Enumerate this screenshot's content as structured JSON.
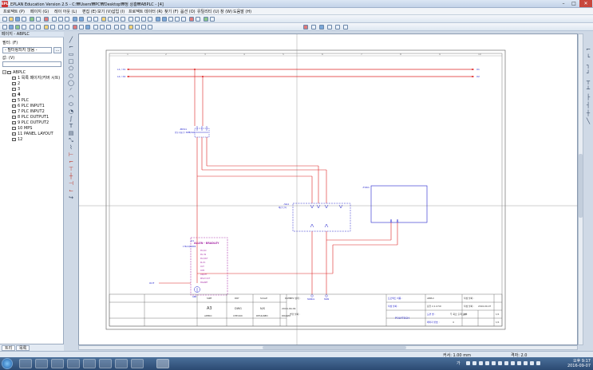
{
  "window": {
    "title": "EPLAN Education Version 2.5 - C:₩Users₩PC₩Desktop₩정 상흠₩ABPLC - [4]",
    "app_icon": "EPLAN"
  },
  "menu": [
    "프로젝트 (P)",
    "페이지 (G)",
    "레이 아웃 (L)",
    "편집 (E)",
    "보기 (V)",
    "삽입 (I)",
    "프로젝트 데이터 (R)",
    "찾기 (F)",
    "옵션 (O)",
    "유틸리티 (U)",
    "창 (W)",
    "도움말 (H)"
  ],
  "left_panel": {
    "header": "페이지 - ABPLC",
    "filter_label": "필터: (F)",
    "filter_value": "- 필터링되지 않음 -",
    "filter_btn": "...",
    "value_label": "값: (V)",
    "tree_root": "ABPLC",
    "pages": [
      "1 목록 페이지(커버 시트)",
      "2",
      "3",
      "4",
      "5 PLC",
      "6 PLC INPUT1",
      "7 PLC INPUT2",
      "8 PLC OUTPUT1",
      "9 PLC OUTPUT2",
      "10 MPS",
      "11 PANEL LAYOUT",
      "12"
    ],
    "tabs": [
      "트리",
      "목록"
    ]
  },
  "schematic": {
    "rails": [
      "L1 / X1",
      "L2 / X2"
    ],
    "rail_end_labels": [
      "X1",
      "X2"
    ],
    "breaker_label": "-BUS1",
    "breaker_sub": "전동기회로 / SMB/SOA",
    "terminal_label": "-SG1",
    "terminal_sub": "배선 단자",
    "box_label": "-TOK1",
    "plc_title": "ALLEN - BRADLEY",
    "plc_ref": "-A1",
    "plc_sub": "1762-IQ8OW6",
    "plc_pins": [
      "PLC/AC",
      "PLC IN",
      "PLC/OUT",
      "RL.PC",
      "OUT",
      "COM",
      "ON/OFF",
      "RELAY OUT",
      "MAGNET"
    ],
    "plc_bottom": "GND",
    "out_label": "OUT",
    "bottom_pins": [
      "SIGNAL",
      "SIGN"
    ]
  },
  "title_block": {
    "headers": [
      "SIZE",
      "DRY",
      "SCALE",
      "DATE"
    ],
    "values": [
      "A3",
      "DWG",
      "N/S",
      "2016-09-09"
    ],
    "footer": [
      "APPRO",
      "CHECKD",
      "DESIGNED",
      "DRAWN"
    ],
    "rev_label": "REV 상태 :",
    "note_label": "변경 날짜 :",
    "company": "POLYTECH",
    "proj_label": "프로젝트 이름 :",
    "proj_value": "ABPLC",
    "created_label": "작성 날짜 :",
    "created_value": "장현 2,1:4:59",
    "date_label": "작성 날짜 :",
    "date_value": "2016-09-07",
    "drawing_label": "도면 명 :",
    "drawing_value": "두 회로 출력 도면",
    "page_label": "페이지 번호 :",
    "page_value": "4",
    "total_label": "총 페이지 :",
    "no_label": "NO",
    "no_value": "1/1",
    "sheet_value": "1/1",
    "ruler": [
      "1",
      "2",
      "3",
      "4",
      "5",
      "6",
      "7",
      "8",
      "9",
      "10"
    ]
  },
  "status_bar": {
    "coords": "커서: 1.00 mm",
    "grid": "격자: 2.0"
  },
  "taskbar": {
    "time": "오후 9:17",
    "date": "2016-09-07",
    "lang": "가"
  }
}
